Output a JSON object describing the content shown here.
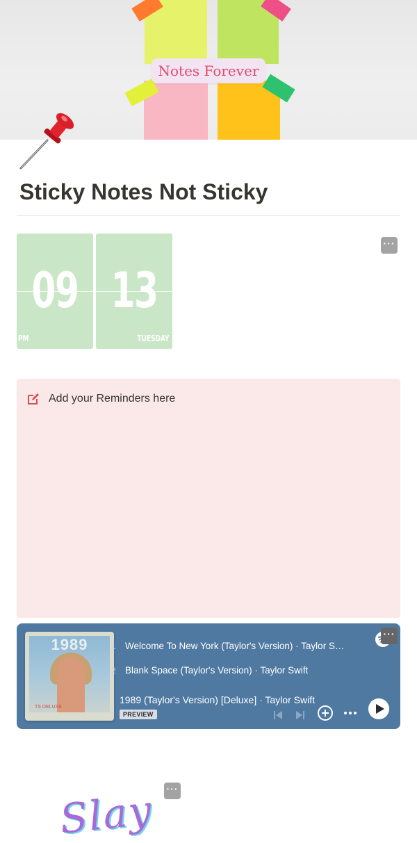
{
  "cover": {
    "label": "Notes Forever"
  },
  "page": {
    "icon": "pushpin-icon",
    "title": "Sticky Notes Not Sticky"
  },
  "clock": {
    "hour": "09",
    "minute": "13",
    "period": "PM",
    "day": "TUESDAY",
    "card_color": "#c9e6c6"
  },
  "more_menu_label": "···",
  "callout": {
    "icon": "edit-icon",
    "text": "Add your Reminders here",
    "background": "#fbe8e8"
  },
  "spotify": {
    "background": "#4f79a1",
    "tracks": [
      {
        "num": "1",
        "title": "Welcome To New York (Taylor's Version) · Taylor Swift"
      },
      {
        "num": "2",
        "title": "Blank Space (Taylor's Version) · Taylor Swift"
      }
    ],
    "album_title": "1989 (Taylor's Version) [Deluxe] · Taylor Swift",
    "badge": "PREVIEW",
    "album_art_year": "1989",
    "album_art_label": "TS  DELUXE"
  },
  "footer_image_text": "Slay"
}
